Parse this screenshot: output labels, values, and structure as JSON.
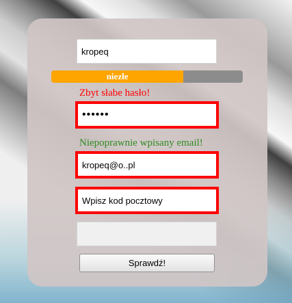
{
  "form": {
    "username_value": "kropeq",
    "password_strength": {
      "label": "niezłe",
      "fraction": 0.69,
      "fill_color": "#ffa500"
    },
    "password_error": "Zbyt słabe hasło!",
    "password_value": "••••••",
    "email_error": "Niepoprawnie wpisany email!",
    "email_value": "kropeq@o..pl",
    "postal_value": "Wpisz kod pocztowy",
    "extra_value": "",
    "submit_label": "Sprawdź!"
  },
  "colors": {
    "error_border": "#ff0000",
    "error_text": "#ff0000",
    "info_text": "#2e8b20",
    "panel": "#d0c6c6"
  }
}
